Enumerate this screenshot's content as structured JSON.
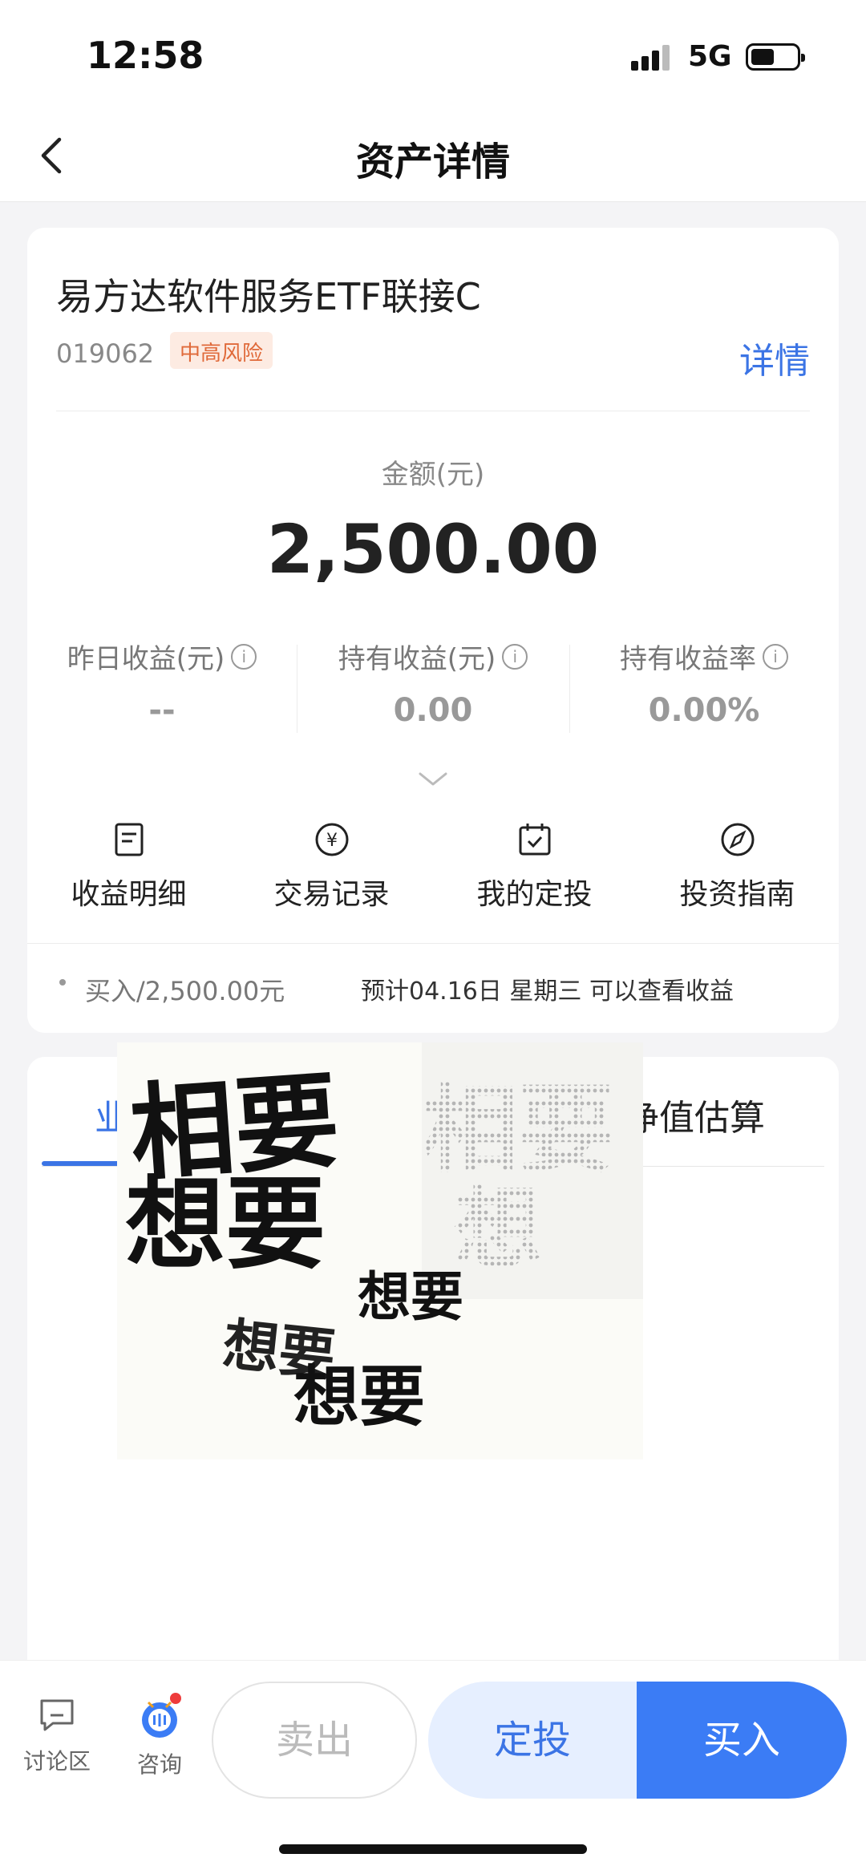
{
  "status_bar": {
    "time": "12:58",
    "network": "5G"
  },
  "nav": {
    "title": "资产详情"
  },
  "fund": {
    "name": "易方达软件服务ETF联接C",
    "code": "019062",
    "risk_level": "中高风险",
    "detail_link": "详情"
  },
  "amount": {
    "label": "金额(元)",
    "value": "2,500.00"
  },
  "stats": [
    {
      "label": "昨日收益(元)",
      "value": "--"
    },
    {
      "label": "持有收益(元)",
      "value": "0.00"
    },
    {
      "label": "持有收益率",
      "value": "0.00%"
    }
  ],
  "actions": [
    {
      "label": "收益明细",
      "icon": "document-icon"
    },
    {
      "label": "交易记录",
      "icon": "yen-icon"
    },
    {
      "label": "我的定投",
      "icon": "calendar-check-icon"
    },
    {
      "label": "投资指南",
      "icon": "compass-icon"
    }
  ],
  "buy_info": {
    "record": "买入/2,500.00元",
    "expected": "预计04.16日 星期三 可以查看收益"
  },
  "chart_tabs": {
    "first_partial": "业",
    "estimate": "净值估算"
  },
  "sticker": {
    "words": [
      "相要",
      "想要",
      "想要",
      "想要",
      "想要",
      "相要",
      "想"
    ]
  },
  "bottom_bar": {
    "discuss_label": "讨论区",
    "consult_label": "咨询",
    "sell_label": "卖出",
    "dca_label": "定投",
    "buy_label": "买入"
  },
  "colors": {
    "accent": "#3b74e5",
    "buy_button": "#3b7cf5",
    "risk": "#e06a3a"
  }
}
